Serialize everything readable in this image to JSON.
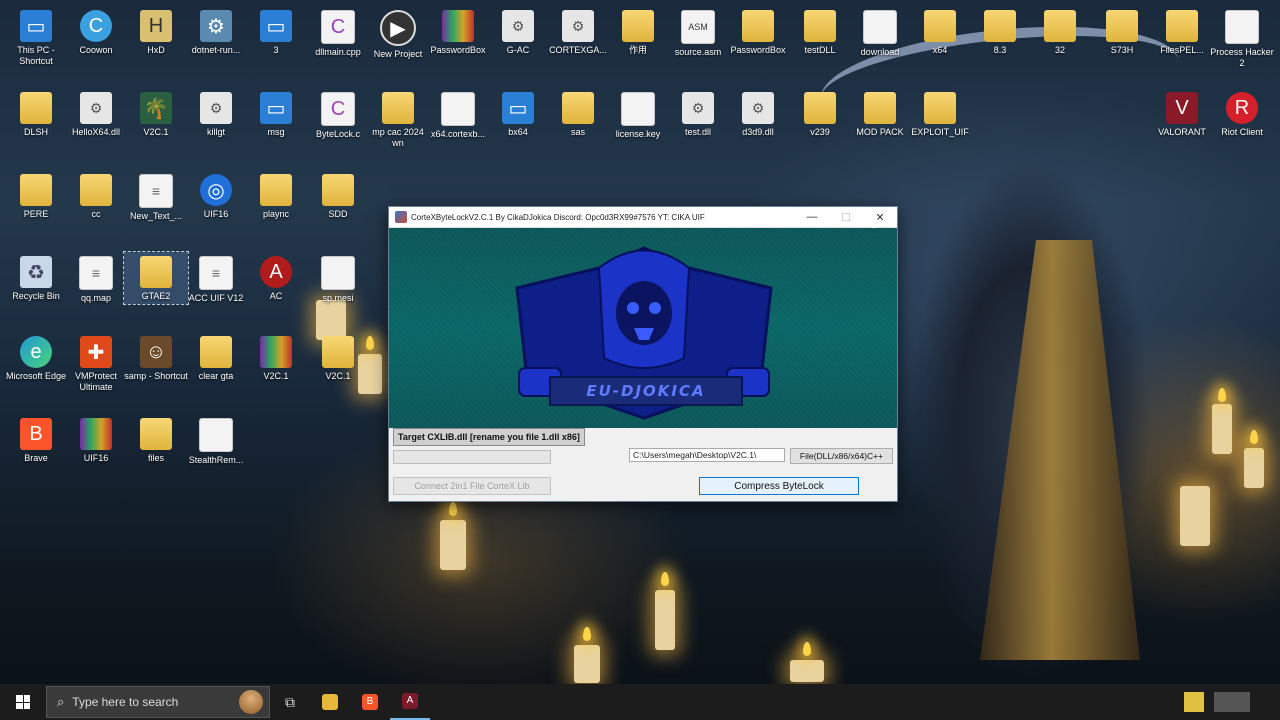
{
  "desktop": {
    "icons": [
      {
        "label": "This PC - Shortcut",
        "icon": "computer-icon"
      },
      {
        "label": "Coowon",
        "icon": "browser-icon"
      },
      {
        "label": "HxD",
        "icon": "hex-editor-icon"
      },
      {
        "label": "dotnet-run...",
        "icon": "installer-icon"
      },
      {
        "label": "3",
        "icon": "window-icon"
      },
      {
        "label": "dllmain.cpp",
        "icon": "cpp-file-icon"
      },
      {
        "label": "New Project",
        "icon": "media-icon"
      },
      {
        "label": "PasswordBox",
        "icon": "winrar-icon"
      },
      {
        "label": "G-AC",
        "icon": "gear-file-icon"
      },
      {
        "label": "CORTEXGA...",
        "icon": "dll-icon"
      },
      {
        "label": "作用",
        "icon": "folder-icon"
      },
      {
        "label": "source.asm",
        "icon": "asm-file-icon"
      },
      {
        "label": "PasswordBox",
        "icon": "folder-icon"
      },
      {
        "label": "testDLL",
        "icon": "folder-icon"
      },
      {
        "label": "download",
        "icon": "file-icon"
      },
      {
        "label": "x64",
        "icon": "folder-icon"
      },
      {
        "label": "8.3",
        "icon": "folder-icon"
      },
      {
        "label": "32",
        "icon": "folder-icon"
      },
      {
        "label": "S73H",
        "icon": "folder-icon"
      },
      {
        "label": "FilesPEL...",
        "icon": "folder-icon"
      },
      {
        "label": "Process Hacker 2",
        "icon": "file-icon"
      },
      {
        "label": "DLSH",
        "icon": "folder-icon"
      },
      {
        "label": "HelloX64.dll",
        "icon": "dll-icon"
      },
      {
        "label": "V2C.1",
        "icon": "palm-icon"
      },
      {
        "label": "killgt",
        "icon": "dll-icon"
      },
      {
        "label": "msg",
        "icon": "window-icon"
      },
      {
        "label": "ByteLock.c",
        "icon": "c-file-icon"
      },
      {
        "label": "mp cac 2024 wn",
        "icon": "folder-icon"
      },
      {
        "label": "x64.cortexb...",
        "icon": "file-icon"
      },
      {
        "label": "bx64",
        "icon": "window-icon"
      },
      {
        "label": "sas",
        "icon": "folder-icon"
      },
      {
        "label": "license.key",
        "icon": "file-icon"
      },
      {
        "label": "test.dll",
        "icon": "dll-icon"
      },
      {
        "label": "d3d9.dll",
        "icon": "dll-icon"
      },
      {
        "label": "v239",
        "icon": "folder-icon"
      },
      {
        "label": "MOD PACK",
        "icon": "folder-icon"
      },
      {
        "label": "EXPLOIT_UIF",
        "icon": "folder-icon"
      },
      {
        "label": "VALORANT",
        "icon": "valorant-icon"
      },
      {
        "label": "Riot Client",
        "icon": "riot-icon"
      },
      {
        "label": "PERE",
        "icon": "folder-icon"
      },
      {
        "label": "cc",
        "icon": "folder-icon"
      },
      {
        "label": "New_Text_...",
        "icon": "text-file-icon"
      },
      {
        "label": "UIF16",
        "icon": "globe-icon"
      },
      {
        "label": "plaync",
        "icon": "folder-icon"
      },
      {
        "label": "SDD",
        "icon": "folder-icon"
      },
      {
        "label": "Recycle Bin",
        "icon": "recycle-bin-icon"
      },
      {
        "label": "qq.map",
        "icon": "text-file-icon"
      },
      {
        "label": "GTAE2",
        "icon": "folder-icon"
      },
      {
        "label": "ACC UIF V12",
        "icon": "text-file-icon"
      },
      {
        "label": "AC",
        "icon": "shield-app-icon"
      },
      {
        "label": "sp.mesi",
        "icon": "file-icon"
      },
      {
        "label": "Microsoft Edge",
        "icon": "edge-icon"
      },
      {
        "label": "VMProtect Ultimate",
        "icon": "puzzle-icon"
      },
      {
        "label": "samp - Shortcut",
        "icon": "game-icon"
      },
      {
        "label": "clear gta",
        "icon": "folder-icon"
      },
      {
        "label": "V2C.1",
        "icon": "winrar-icon"
      },
      {
        "label": "V2C.1",
        "icon": "folder-icon"
      },
      {
        "label": "Brave",
        "icon": "brave-icon"
      },
      {
        "label": "UIF16",
        "icon": "winrar-icon"
      },
      {
        "label": "files",
        "icon": "folder-icon"
      },
      {
        "label": "StealthRem...",
        "icon": "file-icon"
      }
    ]
  },
  "app_window": {
    "title": "CorteXByteLockV2.C.1 By CikaDJokica Discord: Opc0d3RX99#7576 YT: CIKA UIF",
    "minimize": "—",
    "maximize": "☐",
    "close": "✕",
    "logo_text": "EU-DJOKICA",
    "target_label": "Target CXLIB.dll [rename you file 1.dll x86]",
    "progress_percent": 0,
    "path_value": "C:\\Users\\megah\\Desktop\\V2C.1\\",
    "file_button": "File(DLL/x86/x64)C++",
    "connect_button": "Connect 2in1 File CorteX Lib",
    "compress_button": "Compress ByteLock"
  },
  "taskbar": {
    "search_placeholder": "Type here to search",
    "task_view": "⧉",
    "explorer": "📁",
    "brave": "B",
    "app": "A"
  },
  "colors": {
    "banner": "#0e6365",
    "logo_blue": "#1a2b7a",
    "accent": "#0078d7"
  }
}
